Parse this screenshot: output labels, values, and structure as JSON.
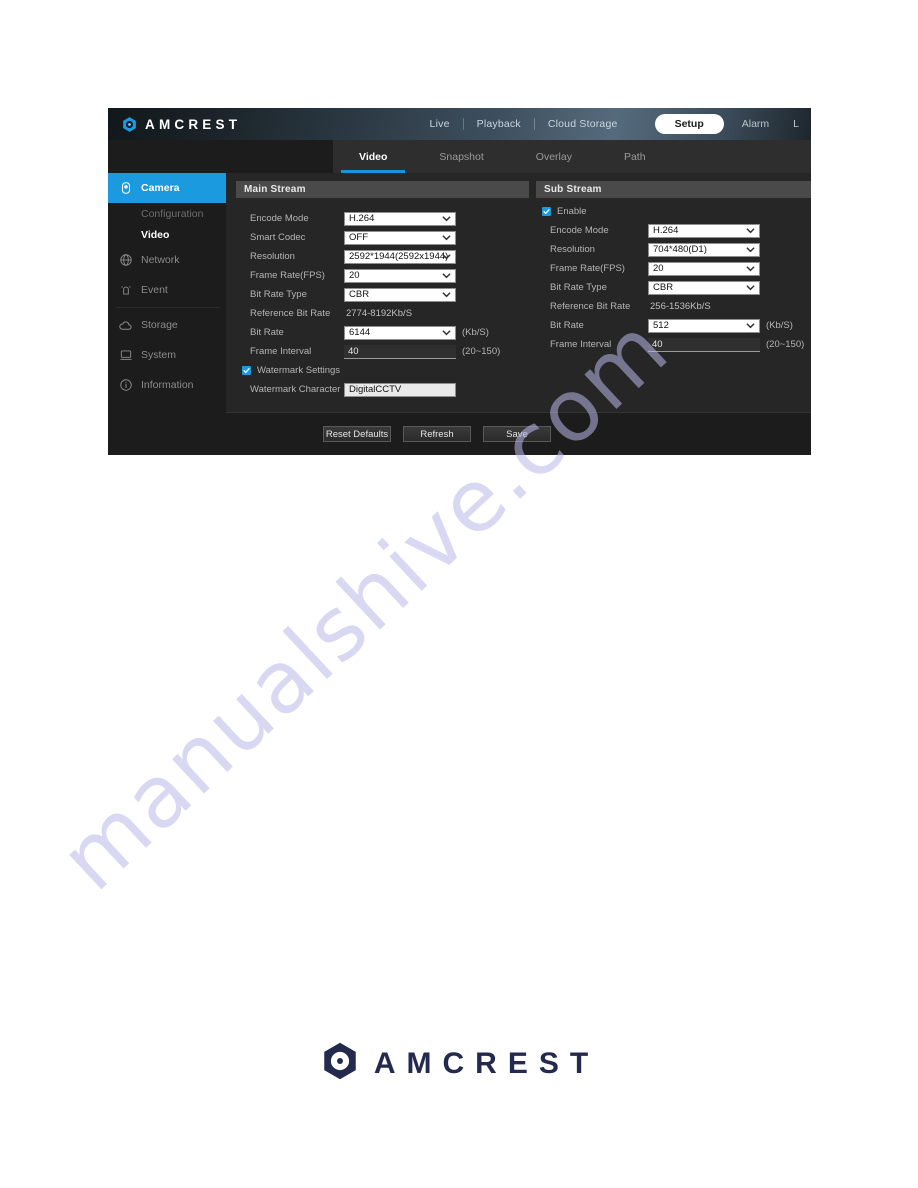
{
  "header": {
    "logo_icon": "amcrest-hexagon-logo-icon",
    "brand": "AMCREST",
    "nav": [
      {
        "label": "Live",
        "active": false
      },
      {
        "label": "Playback",
        "active": false
      },
      {
        "label": "Cloud Storage",
        "active": false
      }
    ],
    "setup_label": "Setup",
    "alarm_label": "Alarm",
    "logout_label": "L"
  },
  "tabs": [
    {
      "label": "Video",
      "active": true
    },
    {
      "label": "Snapshot",
      "active": false
    },
    {
      "label": "Overlay",
      "active": false
    },
    {
      "label": "Path",
      "active": false
    }
  ],
  "sidebar": {
    "items": [
      {
        "label": "Camera",
        "icon": "camera-icon",
        "active": true
      },
      {
        "label": "Network",
        "icon": "network-globe-icon",
        "active": false
      },
      {
        "label": "Event",
        "icon": "event-bell-icon",
        "active": false
      },
      {
        "label": "Storage",
        "icon": "cloud-storage-icon",
        "active": false
      },
      {
        "label": "System",
        "icon": "system-monitor-icon",
        "active": false
      },
      {
        "label": "Information",
        "icon": "information-circle-icon",
        "active": false
      }
    ],
    "sub_items": [
      {
        "label": "Configuration",
        "current": false
      },
      {
        "label": "Video",
        "current": true
      }
    ]
  },
  "main_stream": {
    "title": "Main Stream",
    "encode_mode": {
      "label": "Encode Mode",
      "value": "H.264"
    },
    "smart_codec": {
      "label": "Smart Codec",
      "value": "OFF"
    },
    "resolution": {
      "label": "Resolution",
      "value": "2592*1944(2592x1944)"
    },
    "frame_rate": {
      "label": "Frame Rate(FPS)",
      "value": "20"
    },
    "bit_rate_type": {
      "label": "Bit Rate Type",
      "value": "CBR"
    },
    "reference_bit_rate": {
      "label": "Reference Bit Rate",
      "value": "2774-8192Kb/S"
    },
    "bit_rate": {
      "label": "Bit Rate",
      "value": "6144",
      "suffix": "(Kb/S)"
    },
    "frame_interval": {
      "label": "Frame Interval",
      "value": "40",
      "suffix": "(20~150)"
    },
    "watermark_settings": {
      "label": "Watermark Settings",
      "checked": true
    },
    "watermark_character": {
      "label": "Watermark Character",
      "value": "DigitalCCTV"
    }
  },
  "sub_stream": {
    "title": "Sub Stream",
    "enable": {
      "label": "Enable",
      "checked": true
    },
    "encode_mode": {
      "label": "Encode Mode",
      "value": "H.264"
    },
    "resolution": {
      "label": "Resolution",
      "value": "704*480(D1)"
    },
    "frame_rate": {
      "label": "Frame Rate(FPS)",
      "value": "20"
    },
    "bit_rate_type": {
      "label": "Bit Rate Type",
      "value": "CBR"
    },
    "reference_bit_rate": {
      "label": "Reference Bit Rate",
      "value": "256-1536Kb/S"
    },
    "bit_rate": {
      "label": "Bit Rate",
      "value": "512",
      "suffix": "(Kb/S)"
    },
    "frame_interval": {
      "label": "Frame Interval",
      "value": "40",
      "suffix": "(20~150)"
    }
  },
  "buttons": {
    "reset": "Reset Defaults",
    "refresh": "Refresh",
    "save": "Save"
  },
  "footer": {
    "logo_icon": "amcrest-hexagon-logo-icon",
    "brand": "AMCREST"
  },
  "watermark": {
    "text": "manualshive.com"
  },
  "colors": {
    "accent_blue": "#1b9ae0",
    "panel_bg": "#262626",
    "sidebar_bg": "#1c1c1c",
    "footer_navy": "#242a4e"
  }
}
